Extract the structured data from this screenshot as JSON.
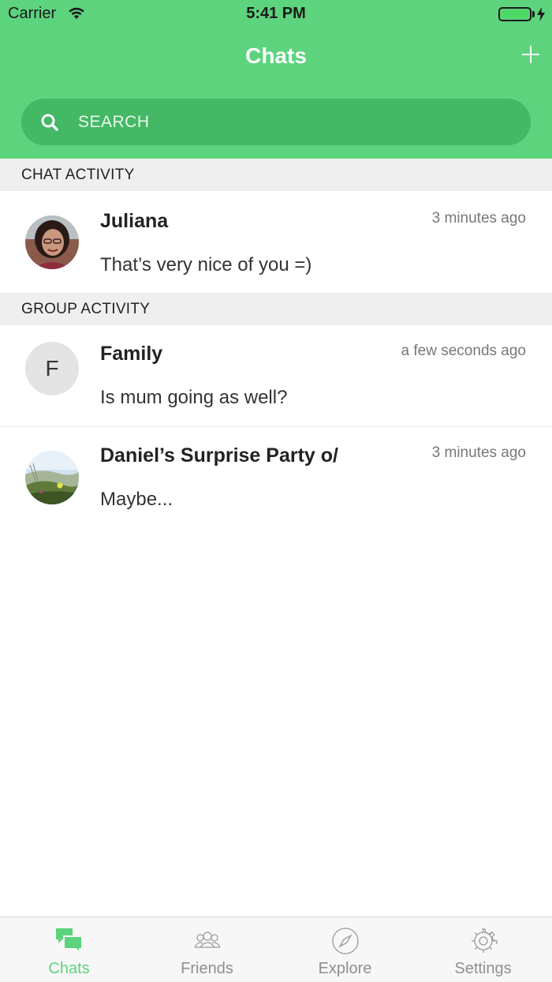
{
  "status_bar": {
    "carrier": "Carrier",
    "time": "5:41 PM",
    "battery_level": 1.0
  },
  "nav": {
    "title": "Chats",
    "add_icon": "plus-icon"
  },
  "search": {
    "placeholder": "SEARCH",
    "icon": "search-icon"
  },
  "sections": {
    "chat_activity": "CHAT ACTIVITY",
    "group_activity": "GROUP ACTIVITY"
  },
  "chats": [
    {
      "name": "Juliana",
      "time": "3 minutes ago",
      "message": "That’s very nice of you =)",
      "avatar": "photo"
    }
  ],
  "groups": [
    {
      "name": "Family",
      "time": "a few seconds ago",
      "message": "Is mum going as well?",
      "avatar_letter": "F"
    },
    {
      "name": "Daniel’s Surprise Party o/",
      "time": "3 minutes ago",
      "message": "Maybe...",
      "avatar": "photo"
    }
  ],
  "tabs": [
    {
      "label": "Chats",
      "icon": "chat-bubbles-icon",
      "active": true
    },
    {
      "label": "Friends",
      "icon": "people-icon",
      "active": false
    },
    {
      "label": "Explore",
      "icon": "compass-icon",
      "active": false
    },
    {
      "label": "Settings",
      "icon": "gear-icon",
      "active": false
    }
  ],
  "colors": {
    "accent": "#5dd37e",
    "search_bg": "#44b865",
    "section_bg": "#efefef",
    "inactive_tab": "#8e8e93"
  }
}
